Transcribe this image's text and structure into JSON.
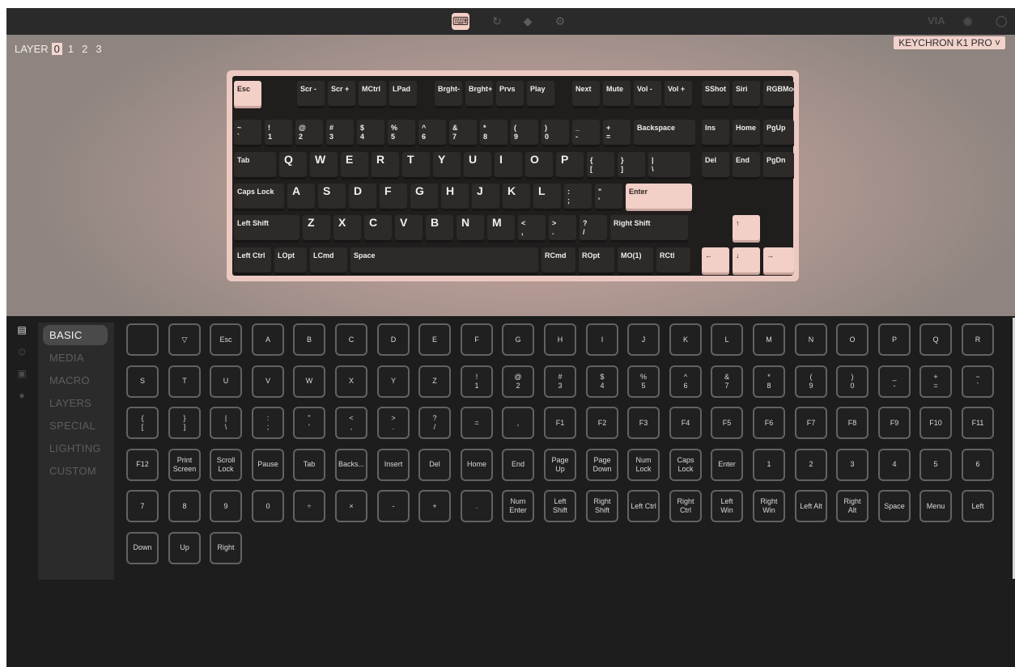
{
  "topbar": {
    "icons": [
      {
        "name": "keyboard-icon",
        "glyph": "⌨",
        "active": true
      },
      {
        "name": "test-icon",
        "glyph": "↻",
        "active": false
      },
      {
        "name": "design-icon",
        "glyph": "◆",
        "active": false
      },
      {
        "name": "settings-icon",
        "glyph": "⚙",
        "active": false
      }
    ],
    "right_logo": "VIA",
    "right_icons": [
      {
        "name": "discord-icon",
        "glyph": "◉"
      },
      {
        "name": "github-icon",
        "glyph": "◯"
      }
    ]
  },
  "layers": {
    "label": "LAYER",
    "items": [
      "0",
      "1",
      "2",
      "3"
    ],
    "selected": "0"
  },
  "keyboard_selector": {
    "value": "KEYCHRON K1 PRO ˅"
  },
  "keyboard": {
    "row0": [
      "Esc",
      "Scr -",
      "Scr +",
      "MCtrl",
      "LPad",
      "Brght-",
      "Brght+",
      "Prvs",
      "Play",
      "Next",
      "Mute",
      "Vol -",
      "Vol +",
      "SShot",
      "Siri",
      "RGBMod"
    ],
    "row1": [
      [
        "~",
        "`"
      ],
      [
        "!",
        "1"
      ],
      [
        "@",
        "2"
      ],
      [
        "#",
        "3"
      ],
      [
        "$",
        "4"
      ],
      [
        "%",
        "5"
      ],
      [
        "^",
        "6"
      ],
      [
        "&",
        "7"
      ],
      [
        "*",
        "8"
      ],
      [
        "(",
        "9"
      ],
      [
        ")",
        "0"
      ],
      [
        "_",
        "-"
      ],
      [
        "+",
        "="
      ],
      [
        "Backspace"
      ],
      [
        "Ins"
      ],
      [
        "Home"
      ],
      [
        "PgUp"
      ]
    ],
    "row2": [
      [
        "Tab"
      ],
      [
        "Q"
      ],
      [
        "W"
      ],
      [
        "E"
      ],
      [
        "R"
      ],
      [
        "T"
      ],
      [
        "Y"
      ],
      [
        "U"
      ],
      [
        "I"
      ],
      [
        "O"
      ],
      [
        "P"
      ],
      [
        "{",
        "["
      ],
      [
        "}",
        "]"
      ],
      [
        "|",
        "\\"
      ],
      [
        "Del"
      ],
      [
        "End"
      ],
      [
        "PgDn"
      ]
    ],
    "row3": [
      [
        "Caps Lock"
      ],
      [
        "A"
      ],
      [
        "S"
      ],
      [
        "D"
      ],
      [
        "F"
      ],
      [
        "G"
      ],
      [
        "H"
      ],
      [
        "J"
      ],
      [
        "K"
      ],
      [
        "L"
      ],
      [
        ":",
        ";"
      ],
      [
        "\"",
        "'"
      ],
      [
        "Enter"
      ]
    ],
    "row4": [
      [
        "Left Shift"
      ],
      [
        "Z"
      ],
      [
        "X"
      ],
      [
        "C"
      ],
      [
        "V"
      ],
      [
        "B"
      ],
      [
        "N"
      ],
      [
        "M"
      ],
      [
        "<",
        ","
      ],
      [
        ">",
        "."
      ],
      [
        "?",
        "/"
      ],
      [
        "Right Shift"
      ],
      [
        "↑"
      ]
    ],
    "row5": [
      [
        "Left Ctrl"
      ],
      [
        "LOpt"
      ],
      [
        "LCmd"
      ],
      [
        "Space"
      ],
      [
        "RCmd"
      ],
      [
        "ROpt"
      ],
      [
        "MO(1)"
      ],
      [
        "RCtl"
      ],
      [
        "←"
      ],
      [
        "↓"
      ],
      [
        "→"
      ]
    ]
  },
  "categories": [
    "BASIC",
    "MEDIA",
    "MACRO",
    "LAYERS",
    "SPECIAL",
    "LIGHTING",
    "CUSTOM"
  ],
  "active_category": "BASIC",
  "side_icons": [
    "keyboard-list-icon",
    "circle-icon",
    "save-icon",
    "bulb-icon"
  ],
  "key_picker": [
    [
      "",
      "▽",
      "Esc",
      "A",
      "B",
      "C",
      "D",
      "E",
      "F",
      "G",
      "H",
      "I",
      "J",
      "K",
      "L",
      "M",
      "N",
      "O",
      "P",
      "Q",
      "R"
    ],
    [
      "S",
      "T",
      "U",
      "V",
      "W",
      "X",
      "Y",
      "Z",
      "!\n1",
      "@\n2",
      "#\n3",
      "$\n4",
      "%\n5",
      "^\n6",
      "&\n7",
      "*\n8",
      "(\n9",
      ")\n0",
      "_\n-",
      "+\n=",
      "~\n`"
    ],
    [
      "{\n[",
      "}\n]",
      "|\n\\",
      ":\n;",
      "\"\n'",
      "<\n,",
      ">\n.",
      "?\n/",
      "=",
      ",",
      "F1",
      "F2",
      "F3",
      "F4",
      "F5",
      "F6",
      "F7",
      "F8",
      "F9",
      "F10",
      "F11"
    ],
    [
      "F12",
      "Print\nScreen",
      "Scroll\nLock",
      "Pause",
      "Tab",
      "Backs...",
      "Insert",
      "Del",
      "Home",
      "End",
      "Page\nUp",
      "Page\nDown",
      "Num\nLock",
      "Caps\nLock",
      "Enter",
      "1",
      "2",
      "3",
      "4",
      "5",
      "6"
    ],
    [
      "7",
      "8",
      "9",
      "0",
      "÷",
      "×",
      "-",
      "+",
      ".",
      "Num\nEnter",
      "Left\nShift",
      "Right\nShift",
      "Left Ctrl",
      "Right\nCtrl",
      "Left\nWin",
      "Right\nWin",
      "Left Alt",
      "Right\nAlt",
      "Space",
      "Menu",
      "Left"
    ],
    [
      "Down",
      "Up",
      "Right"
    ]
  ]
}
